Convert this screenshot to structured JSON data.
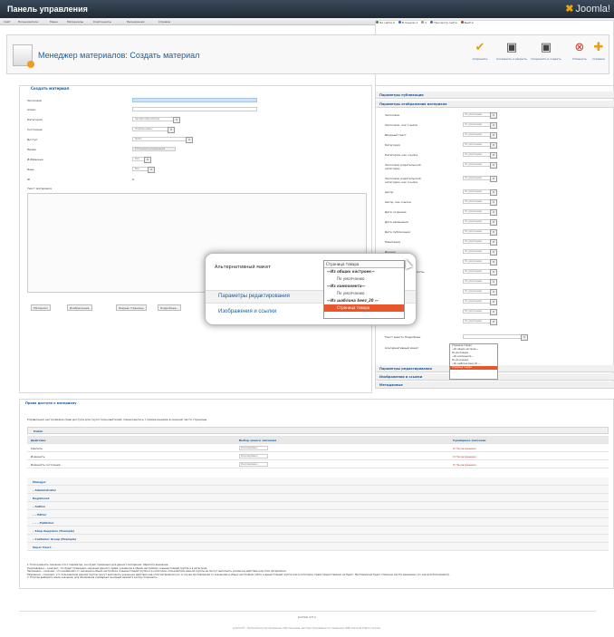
{
  "header": {
    "title": "Панель управления",
    "logo": "Joomla!"
  },
  "menu": {
    "items": [
      "Сайт",
      "Пользователи",
      "Меню",
      "Материалы",
      "Компоненты",
      "Расширения",
      "Справка"
    ],
    "status": [
      "На сайте 0",
      "В панели 1",
      "0",
      "Просмотр сайта",
      "Выйти"
    ]
  },
  "page": {
    "title": "Менеджер материалов: Создать материал"
  },
  "toolbar": {
    "save": "Сохранить",
    "save_close": "Сохранить и закрыть",
    "save_new": "Сохранить и создать",
    "cancel": "Отменить",
    "help": "Справка"
  },
  "form": {
    "legend": "Создать материал",
    "fields": [
      {
        "label": "Заголовок",
        "value": ""
      },
      {
        "label": "Алиас",
        "value": ""
      },
      {
        "label": "Категория",
        "value": "Sample Data-Articles"
      },
      {
        "label": "Состояние",
        "value": "Опубликовано"
      },
      {
        "label": "Доступ",
        "value": "Public"
      },
      {
        "label": "Права",
        "value": "Установить разрешения"
      },
      {
        "label": "Избранные",
        "value": "Нет"
      },
      {
        "label": "Язык",
        "value": "Все"
      },
      {
        "label": "ID",
        "value": "0"
      }
    ],
    "text_label": "Текст материала",
    "editor_buttons": [
      "Материал",
      "Изображение",
      "Разрыв страницы",
      "Подробнее..."
    ]
  },
  "right_panel": {
    "section1": "Параметры публикации",
    "section2": "Параметры отображения материала",
    "default_value": "По умолчанию",
    "rows": [
      "Заголовок",
      "Заголовок, как ссылка",
      "Вводный текст",
      "Категория",
      "Категория, как ссылка",
      "Заголовок родительской категории",
      "Заголовок родительской категории, как ссылка",
      "Автор",
      "Автор, как ссылка",
      "Дата создания",
      "Дата изменения",
      "Дата публикации",
      "Навигация",
      "Иконки",
      "Иконка печати",
      "Иконка электронной почты",
      "Хиты",
      "Недоступные ссылки",
      "Позиция ссылок",
      "Показать/скрыть",
      "Ссылка"
    ],
    "text_more": "Текст вместо Подробнее",
    "alt_layout": "Альтернативный макет",
    "section3": "Параметры редактирования",
    "section4": "Изображения и ссылки",
    "section5": "Метаданные"
  },
  "dropdown_small": [
    "Страница товара",
    "—Из общих настроек—",
    "По умолчанию",
    "—Из компонента—",
    "По умолчанию",
    "—Из шаблона beez_20 —",
    "Страница товара"
  ],
  "popup": {
    "label": "Альтернативный макет",
    "selected": "Страница товара",
    "options": [
      {
        "text": "—Из общих настроек—",
        "kind": "grp"
      },
      {
        "text": "По умолчанию",
        "kind": "opt"
      },
      {
        "text": "—Из компонента—",
        "kind": "grp"
      },
      {
        "text": "По умолчанию",
        "kind": "opt"
      },
      {
        "text": "—Из шаблона beez_20 —",
        "kind": "grp"
      },
      {
        "text": "Страница товара",
        "kind": "hl"
      }
    ],
    "link1": "Параметры редактирования",
    "link2": "Изображения и ссылки"
  },
  "permissions": {
    "title": "Права доступа к материалу",
    "desc": "Управление настройками прав доступа для групп пользователей. Ознакомьтесь с примечаниями в нижней части страницы.",
    "group": "Public",
    "headers": [
      "Действие",
      "Выбор нового значения",
      "Суммарное значение"
    ],
    "rows": [
      {
        "action": "Удалить",
        "select": "Унаследовано",
        "result": "Не разрешено"
      },
      {
        "action": "Изменить",
        "select": "Унаследовано",
        "result": "Не разрешено"
      },
      {
        "action": "Изменить состояние",
        "select": "Унаследовано",
        "result": "Не разрешено"
      }
    ],
    "groups": [
      "Manager",
      "– Administrator",
      "Registered",
      "– Author",
      "– – Editor",
      "– – – Publisher",
      "– Shop Suppliers (Example)",
      "– Customer Group (Example)",
      "Super Users"
    ],
    "notes": [
      "1. Если изменить значение этого параметра, оно будет применено для данного материала. Обратите внимание:",
      "Унаследовано - означает, что будет применено значение данного права, указанное в общих настройках, в вышестоящей группе и в категории.",
      "Запрещено - означает, что независимо от значения в общих настройках, в вышестоящей группе и в категории, пользователи данной группы не смогут выполнить указанное действие над этим материалом.",
      "Разрешено - означает, что пользователи данной группы смогут выполнить указанное действие над этим материалом (но, в случае противоречия со значением в общих настройках сайта, в вышестоящей группе или в категории, право предоставлено не будет. Противоречие будет отмечено как Не разрешено (со значком блокировки)).",
      "2. Если вы выберете новое значение, для обновления суммарных значений нажмите кнопку Сохранить."
    ]
  },
  "footer": {
    "version": "Joomla! 2.5.1",
    "license": "Joomla!® - бесплатное программное обеспечение, распространяемое по лицензии GNU General Public License."
  }
}
